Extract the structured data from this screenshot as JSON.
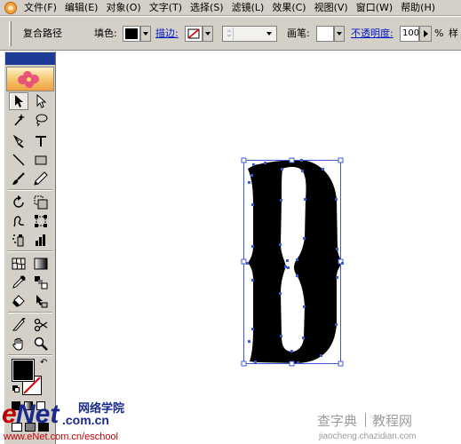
{
  "menubar": {
    "items": [
      {
        "label": "文件(F)"
      },
      {
        "label": "编辑(E)"
      },
      {
        "label": "对象(O)"
      },
      {
        "label": "文字(T)"
      },
      {
        "label": "选择(S)"
      },
      {
        "label": "滤镜(L)"
      },
      {
        "label": "效果(C)"
      },
      {
        "label": "视图(V)"
      },
      {
        "label": "窗口(W)"
      },
      {
        "label": "帮助(H)"
      }
    ]
  },
  "controlbar": {
    "object_type": "复合路径",
    "fill_label": "填色:",
    "stroke_label": "描边:",
    "brush_label": "画笔:",
    "opacity_label": "不透明度:",
    "opacity_value": "100",
    "opacity_unit": "%",
    "style_label": "样",
    "fill_color": "#000000"
  },
  "canvas": {
    "glyph_color": "#000000",
    "selection_color": "#3c5ad2"
  },
  "watermark_left": {
    "brand_e": "e",
    "brand_net": "Net",
    "brand_com": ".com.cn",
    "brand_cn": "网络学院",
    "url": "www.eNet.com.cn/eschool"
  },
  "watermark_right": {
    "name": "查字典",
    "section": "教程网",
    "url": "jiaocheng.chazidian.com"
  },
  "tools": [
    {
      "name": "selection-tool"
    },
    {
      "name": "direct-selection-tool"
    },
    {
      "name": "magic-wand-tool"
    },
    {
      "name": "lasso-tool"
    },
    {
      "name": "pen-tool"
    },
    {
      "name": "type-tool"
    },
    {
      "name": "line-tool"
    },
    {
      "name": "rectangle-tool"
    },
    {
      "name": "paintbrush-tool"
    },
    {
      "name": "pencil-tool"
    },
    {
      "name": "rotate-tool"
    },
    {
      "name": "scale-tool"
    },
    {
      "name": "warp-tool"
    },
    {
      "name": "free-transform-tool"
    },
    {
      "name": "symbol-sprayer-tool"
    },
    {
      "name": "column-graph-tool"
    },
    {
      "name": "mesh-tool"
    },
    {
      "name": "gradient-tool"
    },
    {
      "name": "eyedropper-tool"
    },
    {
      "name": "blend-tool"
    },
    {
      "name": "live-paint-bucket-tool"
    },
    {
      "name": "live-paint-selection-tool"
    },
    {
      "name": "slice-tool"
    },
    {
      "name": "scissors-tool"
    },
    {
      "name": "hand-tool"
    },
    {
      "name": "zoom-tool"
    }
  ]
}
